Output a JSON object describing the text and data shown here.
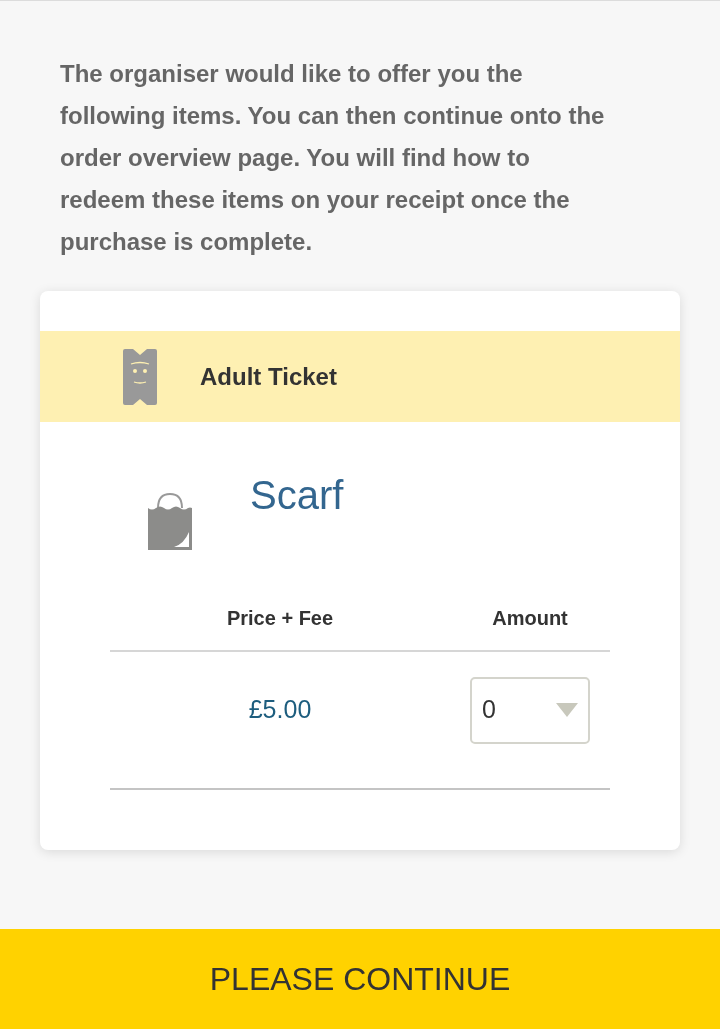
{
  "intro": "The organiser would like to offer you the following items. You can then continue onto the order overview page. You will find how to redeem these items on your receipt once the purchase is complete.",
  "card": {
    "ticket": {
      "name": "Adult Ticket"
    },
    "products": [
      {
        "name": "Scarf",
        "table": {
          "columns": [
            "Price + Fee",
            "Amount"
          ],
          "rows": [
            {
              "price": "£5.00",
              "amount": "0"
            }
          ]
        }
      }
    ]
  },
  "button": {
    "label": "PLEASE CONTINUE"
  }
}
